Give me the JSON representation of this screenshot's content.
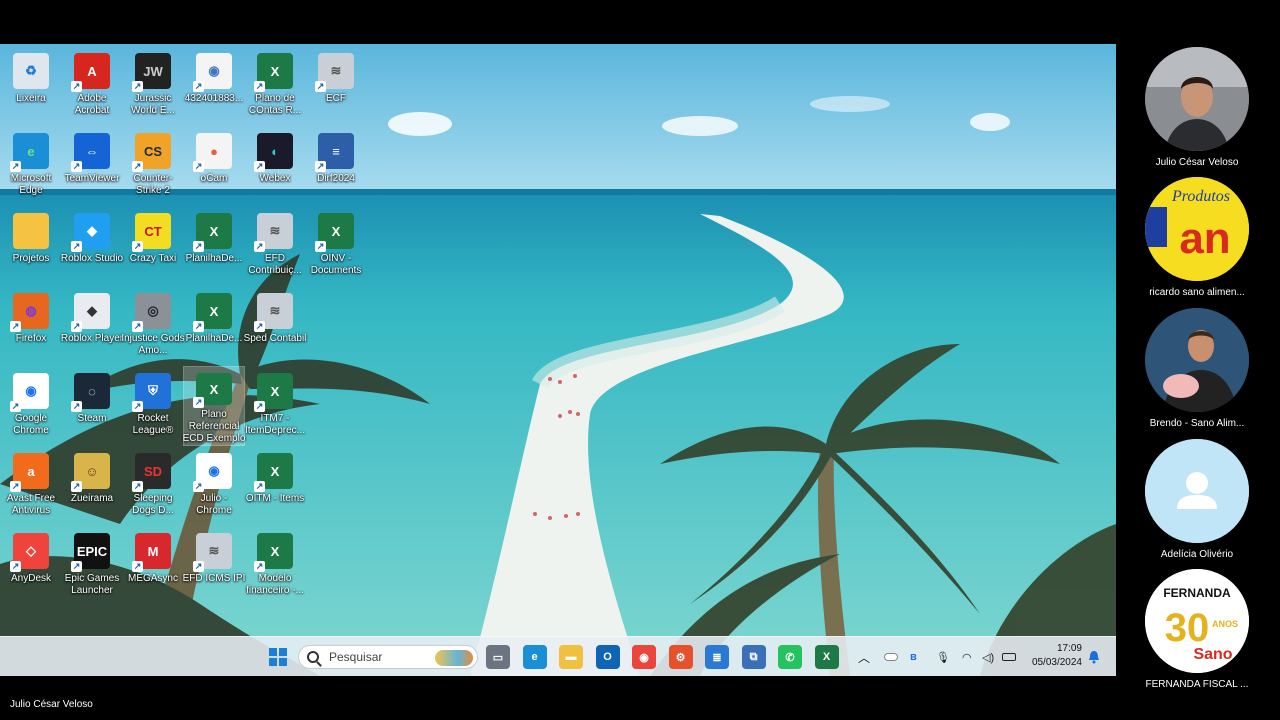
{
  "desktop": {
    "icons": [
      {
        "label": "Lixeira",
        "icon": "recycle-bin-icon",
        "bg": "#dfe6ee",
        "glyph": "♻",
        "fg": "#1f7bd1"
      },
      {
        "label": "Adobe Acrobat",
        "icon": "adobe-acrobat-icon",
        "bg": "#d7261e",
        "glyph": "A",
        "fg": "#fff"
      },
      {
        "label": "Jurassic World E...",
        "icon": "jurassic-world-icon",
        "bg": "#222",
        "glyph": "JW",
        "fg": "#ccc"
      },
      {
        "label": "432401883...",
        "icon": "web-document-icon",
        "bg": "#f4f4f4",
        "glyph": "◉",
        "fg": "#3a76c4"
      },
      {
        "label": "Plano de COntas R...",
        "icon": "excel-file-icon",
        "bg": "#1d7a46",
        "glyph": "X",
        "fg": "#fff"
      },
      {
        "label": "ECF",
        "icon": "receita-program-icon",
        "bg": "#c9cfd6",
        "glyph": "≋",
        "fg": "#555"
      },
      {
        "label": "Microsoft Edge",
        "icon": "edge-icon",
        "bg": "#1b8fd6",
        "glyph": "e",
        "fg": "#6ee07f"
      },
      {
        "label": "TeamViewer",
        "icon": "teamviewer-icon",
        "bg": "#1464d6",
        "glyph": "⇔",
        "fg": "#fff"
      },
      {
        "label": "Counter-Strike 2",
        "icon": "counter-strike-icon",
        "bg": "#f1a327",
        "glyph": "CS",
        "fg": "#1d2a44"
      },
      {
        "label": "oCam",
        "icon": "ocam-icon",
        "bg": "#f4f4f4",
        "glyph": "●",
        "fg": "#e6623b"
      },
      {
        "label": "Webex",
        "icon": "webex-icon",
        "bg": "#1a1a2a",
        "glyph": "◐",
        "fg": "#2fd1c2"
      },
      {
        "label": "Dirf2024",
        "icon": "dirf-icon",
        "bg": "#2d5fa8",
        "glyph": "≡",
        "fg": "#fff"
      },
      {
        "label": "Projetos",
        "icon": "folder-icon",
        "bg": "#f5c242",
        "glyph": "",
        "fg": "#fff"
      },
      {
        "label": "Roblox Studio",
        "icon": "roblox-studio-icon",
        "bg": "#1f9ff2",
        "glyph": "◆",
        "fg": "#fff"
      },
      {
        "label": "Crazy Taxi",
        "icon": "crazy-taxi-icon",
        "bg": "#f3dd22",
        "glyph": "CT",
        "fg": "#c12"
      },
      {
        "label": "PlanilhaDe...",
        "icon": "excel-file-icon",
        "bg": "#1d7a46",
        "glyph": "X",
        "fg": "#fff"
      },
      {
        "label": "EFD Contribuiç...",
        "icon": "receita-program-icon",
        "bg": "#c9cfd6",
        "glyph": "≋",
        "fg": "#555"
      },
      {
        "label": "OINV - Documents",
        "icon": "excel-file-icon",
        "bg": "#1d7a46",
        "glyph": "X",
        "fg": "#fff"
      },
      {
        "label": "Firefox",
        "icon": "firefox-icon",
        "bg": "#e8671f",
        "glyph": "◍",
        "fg": "#7a3bd9"
      },
      {
        "label": "Roblox Player",
        "icon": "roblox-player-icon",
        "bg": "#e8ecf0",
        "glyph": "◆",
        "fg": "#333"
      },
      {
        "label": "Injustice Gods Amo...",
        "icon": "injustice-icon",
        "bg": "#8c9198",
        "glyph": "◎",
        "fg": "#222"
      },
      {
        "label": "PlanilhaDe...",
        "icon": "excel-file-icon",
        "bg": "#1d7a46",
        "glyph": "X",
        "fg": "#fff"
      },
      {
        "label": "Sped Contabil",
        "icon": "receita-program-icon",
        "bg": "#c9cfd6",
        "glyph": "≋",
        "fg": "#555"
      },
      {
        "label": "Google Chrome",
        "icon": "chrome-icon",
        "bg": "#ffffff",
        "glyph": "◉",
        "fg": "#1a73e8"
      },
      {
        "label": "Steam",
        "icon": "steam-icon",
        "bg": "#1b2838",
        "glyph": "◌",
        "fg": "#fff"
      },
      {
        "label": "Rocket League®",
        "icon": "rocket-league-icon",
        "bg": "#2072d8",
        "glyph": "⛨",
        "fg": "#fff"
      },
      {
        "label": "Plano Referencial ECD Exemplo",
        "icon": "excel-file-icon",
        "bg": "#1d7a46",
        "glyph": "X",
        "fg": "#fff"
      },
      {
        "label": "ITM7 - ItemDeprec...",
        "icon": "excel-file-icon",
        "bg": "#1d7a46",
        "glyph": "X",
        "fg": "#fff"
      },
      {
        "label": "Avast Free Antivirus",
        "icon": "avast-icon",
        "bg": "#f26b1d",
        "glyph": "a",
        "fg": "#fff"
      },
      {
        "label": "Zueirama",
        "icon": "zueirama-icon",
        "bg": "#d9b44a",
        "glyph": "☺",
        "fg": "#6b3a12"
      },
      {
        "label": "Sleeping Dogs D...",
        "icon": "sleeping-dogs-icon",
        "bg": "#2a2a2a",
        "glyph": "SD",
        "fg": "#e33"
      },
      {
        "label": "Julio - Chrome",
        "icon": "chrome-profile-icon",
        "bg": "#ffffff",
        "glyph": "◉",
        "fg": "#1a73e8"
      },
      {
        "label": "OITM - Items",
        "icon": "excel-file-icon",
        "bg": "#1d7a46",
        "glyph": "X",
        "fg": "#fff"
      },
      {
        "label": "AnyDesk",
        "icon": "anydesk-icon",
        "bg": "#ef443b",
        "glyph": "◇",
        "fg": "#fff"
      },
      {
        "label": "Epic Games Launcher",
        "icon": "epic-games-icon",
        "bg": "#111",
        "glyph": "EPIC",
        "fg": "#fff"
      },
      {
        "label": "MEGAsync",
        "icon": "mega-icon",
        "bg": "#d9272e",
        "glyph": "M",
        "fg": "#fff"
      },
      {
        "label": "EFD ICMS IPI",
        "icon": "receita-program-icon",
        "bg": "#c9cfd6",
        "glyph": "≋",
        "fg": "#555"
      },
      {
        "label": "Modelo financeiro -...",
        "icon": "excel-file-icon",
        "bg": "#1d7a46",
        "glyph": "X",
        "fg": "#fff"
      }
    ]
  },
  "taskbar": {
    "search_placeholder": "Pesquisar",
    "apps": [
      {
        "icon": "task-view-icon",
        "bg": "#6b7480",
        "glyph": "▭"
      },
      {
        "icon": "edge-icon",
        "bg": "#1b8fd6",
        "glyph": "e"
      },
      {
        "icon": "file-explorer-icon",
        "bg": "#f2c041",
        "glyph": "▬"
      },
      {
        "icon": "outlook-icon",
        "bg": "#0f64b4",
        "glyph": "O"
      },
      {
        "icon": "chrome-icon",
        "bg": "#e9453b",
        "glyph": "◉"
      },
      {
        "icon": "sap-app-icon",
        "bg": "#e5512a",
        "glyph": "⚙"
      },
      {
        "icon": "notepad-icon",
        "bg": "#2a7ad4",
        "glyph": "≣"
      },
      {
        "icon": "rdp-icon",
        "bg": "#3b6fb8",
        "glyph": "⧉"
      },
      {
        "icon": "whatsapp-icon",
        "bg": "#25c35f",
        "glyph": "✆"
      },
      {
        "icon": "excel-icon",
        "bg": "#1d7a46",
        "glyph": "X"
      }
    ],
    "time": "17:09",
    "date": "05/03/2024"
  },
  "participants": [
    {
      "name": "Julio César Veloso",
      "avatar": "video-tile-julio"
    },
    {
      "name": "ricardo sano alimen...",
      "avatar": "logo-sano-produtos"
    },
    {
      "name": "Brendo - Sano Alim...",
      "avatar": "video-tile-brendo"
    },
    {
      "name": "Adelícia  Olivério",
      "avatar": "default-user-avatar"
    },
    {
      "name": "FERNANDA FISCAL ...",
      "avatar": "logo-fernanda-30-anos",
      "logo_title": "FERNANDA",
      "logo_years": "30",
      "logo_anos": "ANOS",
      "logo_brand": "Sano"
    }
  ],
  "presenter_name": "Julio César Veloso"
}
